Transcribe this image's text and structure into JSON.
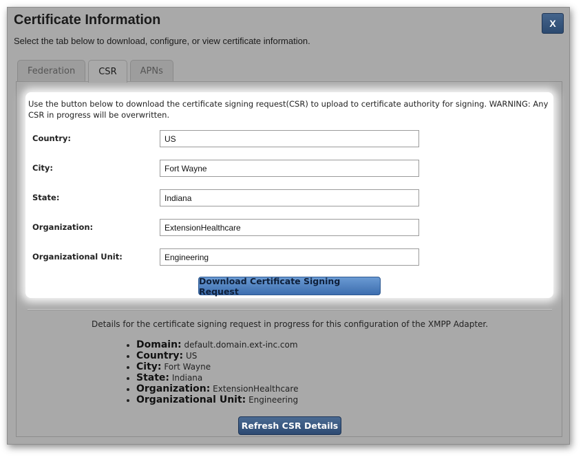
{
  "dialog": {
    "title": "Certificate Information",
    "subtitle": "Select the tab below to download, configure, or view certificate information.",
    "close_label": "X"
  },
  "tabs": [
    {
      "label": "Federation",
      "active": false
    },
    {
      "label": "CSR",
      "active": true
    },
    {
      "label": "APNs",
      "active": false
    }
  ],
  "csr_form": {
    "intro": "Use the button below to download the certificate signing request(CSR) to upload to certificate authority for signing. WARNING: Any CSR in progress will be overwritten.",
    "fields": [
      {
        "label": "Country:",
        "value": "US"
      },
      {
        "label": "City:",
        "value": "Fort Wayne"
      },
      {
        "label": "State:",
        "value": "Indiana"
      },
      {
        "label": "Organization:",
        "value": "ExtensionHealthcare"
      },
      {
        "label": "Organizational Unit:",
        "value": "Engineering"
      }
    ],
    "download_label": "Download Certificate Signing Request"
  },
  "details": {
    "intro": "Details for the certificate signing request in progress for this configuration of the XMPP Adapter.",
    "items": [
      {
        "key": "Domain:",
        "value": "default.domain.ext-inc.com"
      },
      {
        "key": "Country:",
        "value": "US"
      },
      {
        "key": "City:",
        "value": "Fort Wayne"
      },
      {
        "key": "State:",
        "value": "Indiana"
      },
      {
        "key": "Organization:",
        "value": "ExtensionHealthcare"
      },
      {
        "key": "Organizational Unit:",
        "value": "Engineering"
      }
    ],
    "refresh_label": "Refresh CSR Details"
  }
}
